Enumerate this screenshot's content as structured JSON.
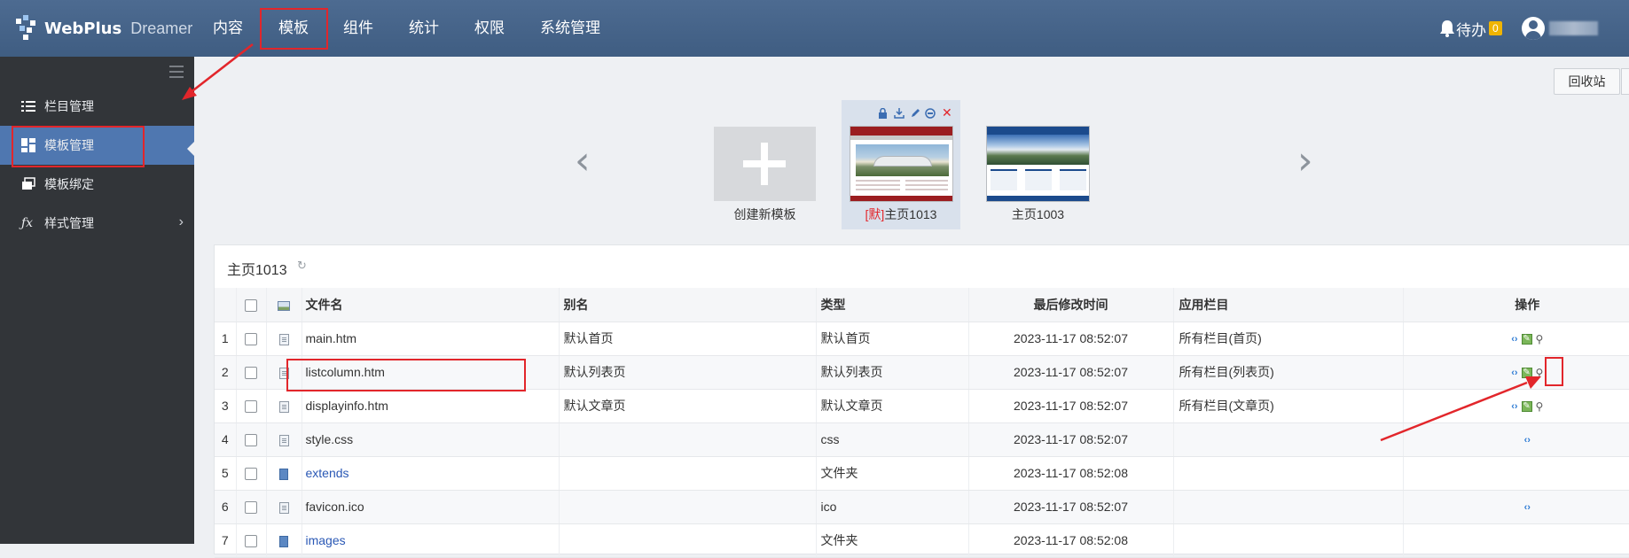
{
  "header": {
    "brand": "WebPlus",
    "product": "Dreamer",
    "nav": [
      "内容",
      "模板",
      "组件",
      "统计",
      "权限",
      "系统管理"
    ],
    "active_nav": "模板",
    "todo_label": "待办",
    "todo_count": "0"
  },
  "sidebar": {
    "items": [
      {
        "label": "栏目管理",
        "icon": "list-icon"
      },
      {
        "label": "模板管理",
        "icon": "grid-icon",
        "active": true
      },
      {
        "label": "模板绑定",
        "icon": "stack-icon"
      },
      {
        "label": "样式管理",
        "icon": "fx-icon",
        "has_children": true
      }
    ]
  },
  "toolbar": {
    "recycle_label": "回收站"
  },
  "templates": {
    "new_label": "创建新模板",
    "items": [
      {
        "default_tag": "[默]",
        "name": "主页1013",
        "selected": true
      },
      {
        "name": "主页1003"
      }
    ]
  },
  "panel": {
    "title": "主页1013",
    "columns": [
      "文件名",
      "别名",
      "类型",
      "最后修改时间",
      "应用栏目",
      "操作"
    ],
    "rows": [
      {
        "no": "1",
        "name": "main.htm",
        "alias": "默认首页",
        "type": "默认首页",
        "time": "2023-11-17 08:52:07",
        "column": "所有栏目(首页)",
        "kind": "page",
        "ops": [
          "code",
          "edit",
          "view"
        ]
      },
      {
        "no": "2",
        "name": "listcolumn.htm",
        "alias": "默认列表页",
        "type": "默认列表页",
        "time": "2023-11-17 08:52:07",
        "column": "所有栏目(列表页)",
        "kind": "page",
        "ops": [
          "code",
          "edit",
          "view"
        ]
      },
      {
        "no": "3",
        "name": "displayinfo.htm",
        "alias": "默认文章页",
        "type": "默认文章页",
        "time": "2023-11-17 08:52:07",
        "column": "所有栏目(文章页)",
        "kind": "page",
        "ops": [
          "code",
          "edit",
          "view"
        ]
      },
      {
        "no": "4",
        "name": "style.css",
        "alias": "",
        "type": "css",
        "time": "2023-11-17 08:52:07",
        "column": "",
        "kind": "doc",
        "ops": [
          "code"
        ]
      },
      {
        "no": "5",
        "name": "extends",
        "alias": "",
        "type": "文件夹",
        "time": "2023-11-17 08:52:08",
        "column": "",
        "kind": "folder",
        "ops": []
      },
      {
        "no": "6",
        "name": "favicon.ico",
        "alias": "",
        "type": "ico",
        "time": "2023-11-17 08:52:07",
        "column": "",
        "kind": "doc",
        "ops": [
          "code"
        ]
      },
      {
        "no": "7",
        "name": "images",
        "alias": "",
        "type": "文件夹",
        "time": "2023-11-17 08:52:08",
        "column": "",
        "kind": "folder",
        "ops": []
      }
    ]
  },
  "colors": {
    "header_bg": "#45638a",
    "sidebar_bg": "#323539",
    "sidebar_active": "#4f77b0",
    "annotation_red": "#e2262b",
    "link_blue": "#2a58b5"
  }
}
